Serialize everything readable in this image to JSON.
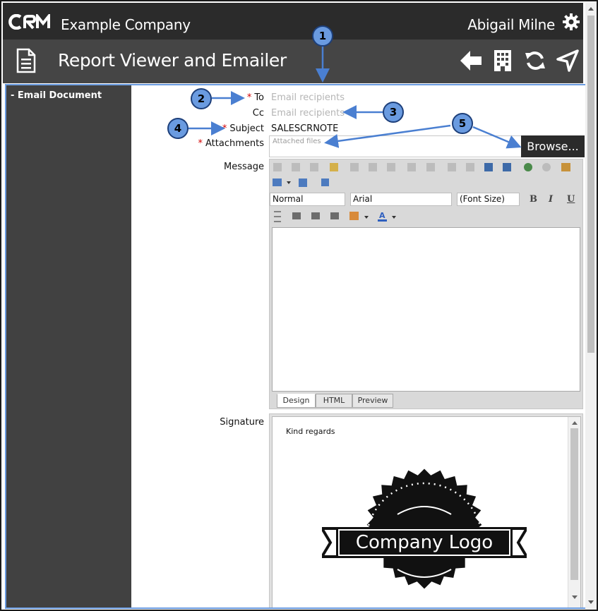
{
  "topbar": {
    "logo_text": "CRM",
    "company": "Example Company",
    "user": "Abigail Milne"
  },
  "titlebar": {
    "title": "Report Viewer and Emailer"
  },
  "sidebar": {
    "item": "- Email Document"
  },
  "form": {
    "to_label": "To",
    "to_placeholder": "Email recipients",
    "cc_label": "Cc",
    "cc_placeholder": "Email recipients",
    "subject_label": "Subject",
    "subject_value": "SALESCRNOTE",
    "attachments_label": "Attachments",
    "attachments_placeholder": "Attached files",
    "browse_label": "Browse...",
    "message_label": "Message",
    "signature_label": "Signature",
    "required_mark": "*"
  },
  "editor": {
    "format_value": "Normal",
    "font_value": "Arial",
    "size_value": "(Font Size)",
    "bold": "B",
    "italic": "I",
    "underline": "U",
    "tabs": [
      "Design",
      "HTML",
      "Preview"
    ]
  },
  "signature": {
    "text": "Kind regards",
    "logo_text": "Company Logo"
  },
  "callouts": [
    "1",
    "2",
    "3",
    "4",
    "5"
  ],
  "colors": {
    "accent": "#6a9be0",
    "topbar": "#2b2b2b",
    "titlebar": "#454545",
    "sidebar": "#414141",
    "required": "#d40000"
  }
}
